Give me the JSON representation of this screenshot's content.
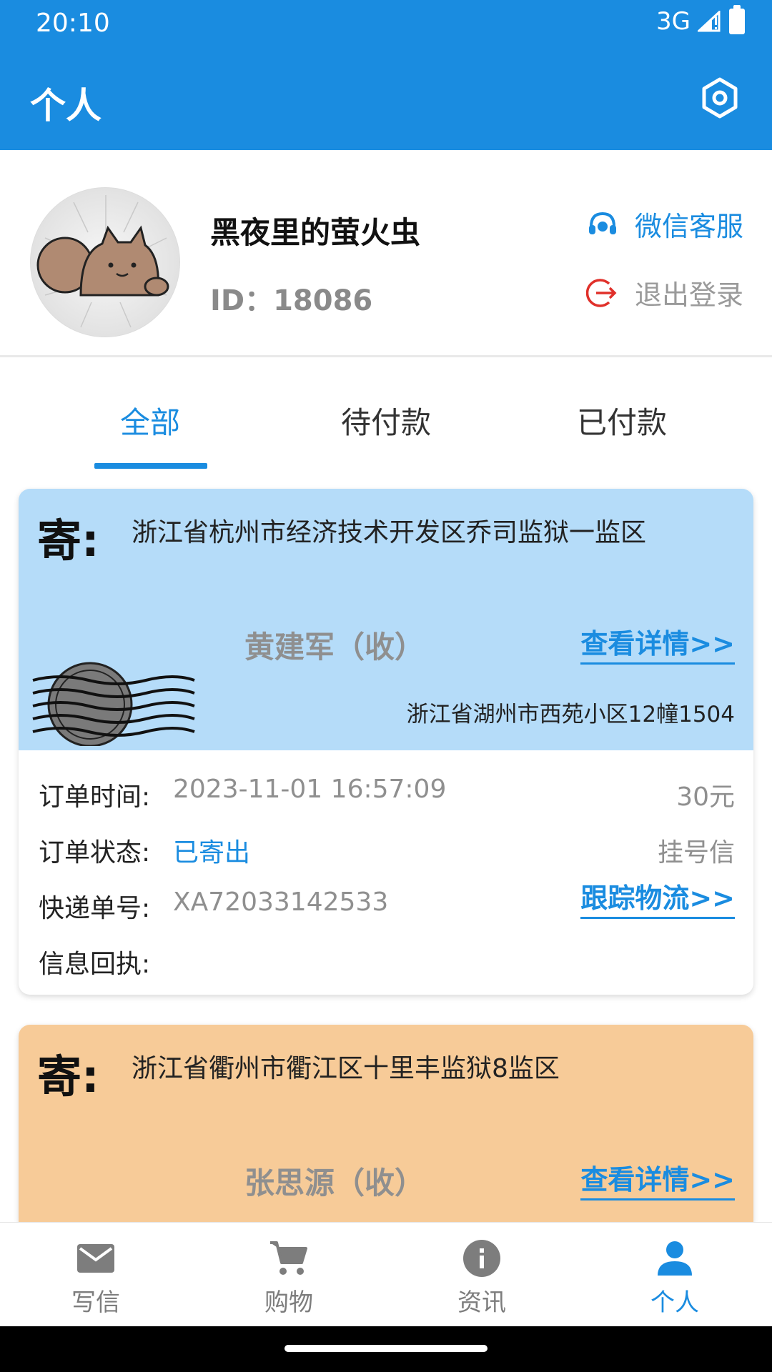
{
  "status_bar": {
    "time": "20:10",
    "network": "3G"
  },
  "header": {
    "title": "个人"
  },
  "profile": {
    "nickname": "黑夜里的萤火虫",
    "id_text": "ID：18086",
    "service_label": "微信客服",
    "logout_label": "退出登录"
  },
  "tabs": [
    {
      "label": "全部",
      "active": true
    },
    {
      "label": "待付款",
      "active": false
    },
    {
      "label": "已付款",
      "active": false
    }
  ],
  "orders": [
    {
      "color": "#b5dcf9",
      "send_label": "寄:",
      "from_address": "浙江省杭州市经济技术开发区乔司监狱一监区",
      "recipient": "黄建军（收）",
      "detail_link": "查看详情>>",
      "to_address": "浙江省湖州市西苑小区12幢1504",
      "order_time_label": "订单时间:",
      "order_time": "2023-11-01 16:57:09",
      "price": "30元",
      "status_label": "订单状态:",
      "status": "已寄出",
      "mail_type": "挂号信",
      "tracking_label": "快递单号:",
      "tracking_no": "XA72033142533",
      "track_link": "跟踪物流>>",
      "receipt_label": "信息回执:"
    },
    {
      "color": "#f7cb98",
      "send_label": "寄:",
      "from_address": "浙江省衢州市衢江区十里丰监狱8监区",
      "recipient": "张思源（收）",
      "detail_link": "查看详情>>"
    }
  ],
  "bottom_nav": [
    {
      "label": "写信",
      "icon": "mail-icon",
      "active": false
    },
    {
      "label": "购物",
      "icon": "cart-icon",
      "active": false
    },
    {
      "label": "资讯",
      "icon": "info-icon",
      "active": false
    },
    {
      "label": "个人",
      "icon": "person-icon",
      "active": true
    }
  ],
  "colors": {
    "primary": "#1a8ce0",
    "card_blue": "#b5dcf9",
    "card_orange": "#f7cb98"
  }
}
